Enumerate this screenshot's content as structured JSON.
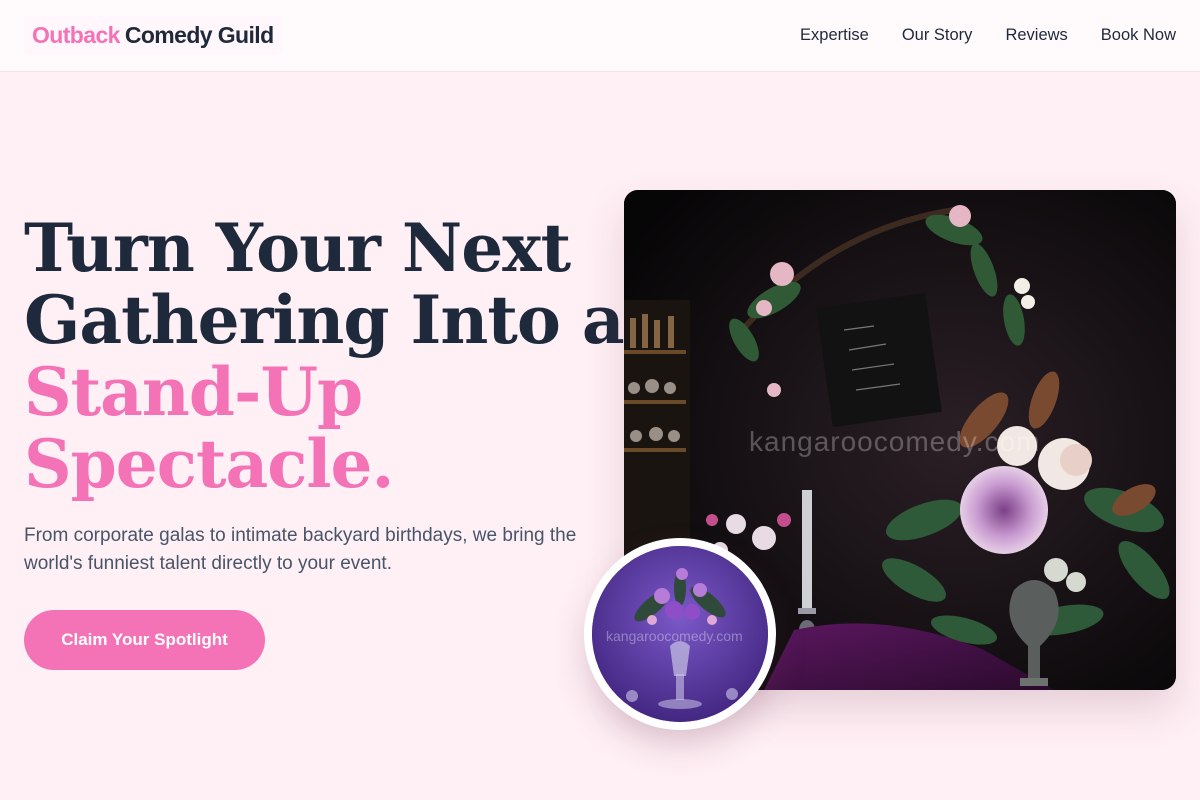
{
  "header": {
    "logo_part1": "Outback",
    "logo_part2": "Comedy Guild",
    "nav": [
      "Expertise",
      "Our Story",
      "Reviews",
      "Book Now"
    ]
  },
  "hero": {
    "title_line1": "Turn Your Next",
    "title_line2": "Gathering Into a",
    "title_accent_line1": "Stand-Up",
    "title_accent_line2": "Spectacle.",
    "subtitle": "From corporate galas to intimate backyard birthdays, we bring the world's funniest talent directly to your event.",
    "cta_label": "Claim Your Spotlight"
  },
  "media": {
    "main_watermark": "kangaroocomedy.com",
    "inset_watermark": "kangaroocomedy.com"
  },
  "colors": {
    "accent": "#f472b6",
    "text": "#1e293b",
    "page_bg": "#fff0f5"
  }
}
